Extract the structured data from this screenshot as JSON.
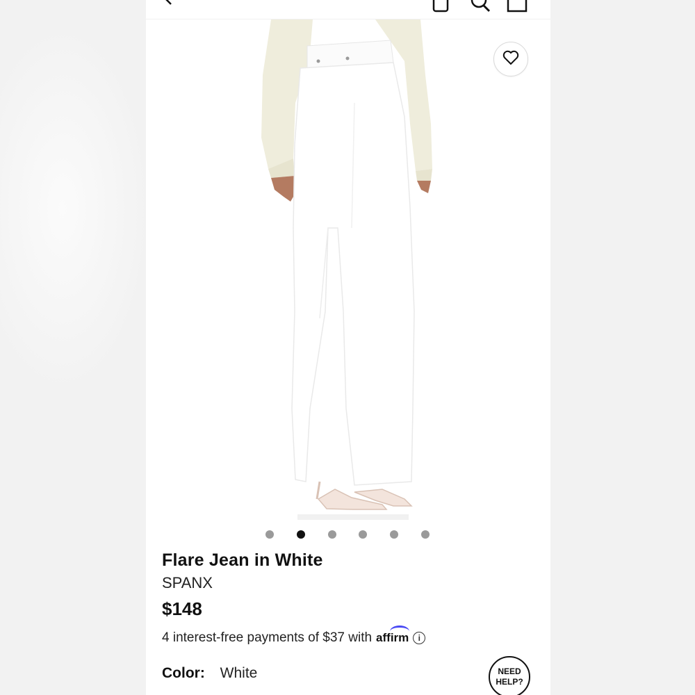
{
  "topbar": {
    "icons": [
      "back-chevron-icon",
      "account-icon",
      "search-icon",
      "bag-icon"
    ]
  },
  "gallery": {
    "image_alt": "model wearing white flare jeans with cream sweater and nude heeled sandals",
    "dot_count": 6,
    "active_index": 1
  },
  "product": {
    "title": "Flare Jean in White",
    "brand": "SPANX",
    "price": "$148"
  },
  "payments": {
    "text": "4 interest-free payments of $37 with",
    "provider": "affirm",
    "info_icon": "i"
  },
  "color": {
    "label": "Color",
    "separator": ":",
    "value": "White"
  },
  "help": {
    "line1": "NEED",
    "line2": "HELP?"
  },
  "colors": {
    "affirm_blue": "#4a4af4",
    "sweater": "#efeddc",
    "jeans": "#ffffff"
  }
}
